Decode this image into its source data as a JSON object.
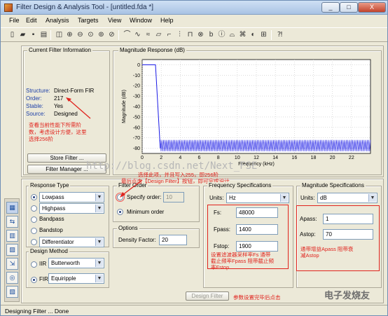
{
  "window": {
    "title": "Filter Design & Analysis Tool - [untitled.fda *]",
    "minimize": "_",
    "maximize": "□",
    "close": "X"
  },
  "menu": [
    "File",
    "Edit",
    "Analysis",
    "Targets",
    "View",
    "Window",
    "Help"
  ],
  "current_filter": {
    "title": "Current Filter Information",
    "structure_label": "Structure:",
    "structure_value": "Direct-Form FIR",
    "order_label": "Order:",
    "order_value": "217",
    "stable_label": "Stable:",
    "stable_value": "Yes",
    "source_label": "Source:",
    "source_value": "Designed",
    "annotation": "查看当前性能下所需阶数，考虑设计方便，这里选择256阶",
    "store_button": "Store Filter ...",
    "manager_button": "Filter Manager ..."
  },
  "magnitude": {
    "title": "Magnitude Response (dB)"
  },
  "chart_data": {
    "type": "line",
    "title": "",
    "xlabel": "Frequency (kHz)",
    "ylabel": "Magnitude (dB)",
    "xlim": [
      0,
      24
    ],
    "ylim": [
      -85,
      5
    ],
    "xticks": [
      0,
      2,
      4,
      6,
      8,
      10,
      12,
      14,
      16,
      18,
      20,
      22
    ],
    "yticks": [
      0,
      -10,
      -20,
      -30,
      -40,
      -50,
      -60,
      -70,
      -80
    ],
    "grid": true,
    "series": [
      {
        "color": "#1a1ae6",
        "passband": {
          "x": [
            0,
            1.4
          ],
          "y": 0
        },
        "transition": {
          "x": [
            1.4,
            1.9
          ],
          "y": [
            0,
            -80
          ]
        },
        "stopband": {
          "x": [
            1.9,
            24
          ],
          "y_max": -72,
          "y_min": -83
        }
      }
    ]
  },
  "annotations": {
    "order_note": "选择此项，并且写入255，即256阶",
    "design_note": "最后点击【Design Filter】按钮，即可完成设计",
    "freq_note": "设置滤波器采样率Fs 通带截止频率Fpass 阻带截止频率Fstop",
    "mag_note": "通带增益Apass 阻带衰减Astop",
    "done_note": "参数设置完毕后点击",
    "watermark": "http://blog.csdn.net/Next_FSE",
    "logo": "电子发烧友"
  },
  "response_type": {
    "title": "Response Type",
    "options": [
      "Lowpass",
      "Highpass",
      "Bandpass",
      "Bandstop",
      "Differentiator"
    ],
    "selected": "Lowpass"
  },
  "design_method": {
    "title": "Design Method",
    "iir_label": "IIR",
    "iir_value": "Butterworth",
    "fir_label": "FIR",
    "fir_value": "Equiripple"
  },
  "filter_order": {
    "title": "Filter Order",
    "specify_label": "Specify order:",
    "specify_value": "10",
    "minimum_label": "Minimum order"
  },
  "options": {
    "title": "Options",
    "density_label": "Density Factor:",
    "density_value": "20"
  },
  "frequency_specs": {
    "title": "Frequency Specifications",
    "units_label": "Units:",
    "units_value": "Hz",
    "fs_label": "Fs:",
    "fs_value": "48000",
    "fpass_label": "Fpass:",
    "fpass_value": "1400",
    "fstop_label": "Fstop:",
    "fstop_value": "1900"
  },
  "magnitude_specs": {
    "title": "Magnitude Specifications",
    "units_label": "Units:",
    "units_value": "dB",
    "apass_label": "Apass:",
    "apass_value": "1",
    "astop_label": "Astop:",
    "astop_value": "70"
  },
  "design_button": "Design Filter",
  "status": "Designing Filter ... Done"
}
